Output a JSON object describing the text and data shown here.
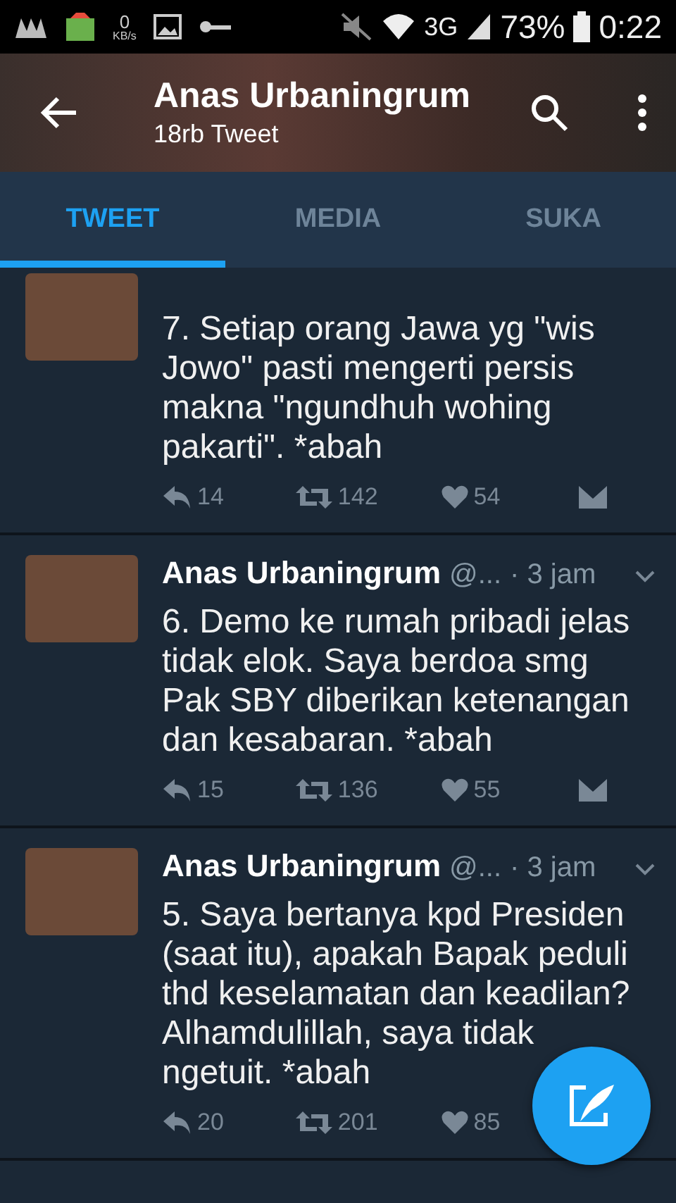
{
  "status_bar": {
    "speed_value": "0",
    "speed_unit": "KB/s",
    "network": "3G",
    "battery": "73%",
    "time": "0:22"
  },
  "header": {
    "title": "Anas Urbaningrum",
    "subtitle": "18rb Tweet"
  },
  "tabs": [
    {
      "label": "TWEET",
      "selected": true
    },
    {
      "label": "MEDIA",
      "selected": false
    },
    {
      "label": "SUKA",
      "selected": false
    }
  ],
  "tweets": [
    {
      "text": "7. Setiap orang Jawa yg \"wis Jowo\" pasti mengerti persis makna \"ngundhuh wohing pakarti\". *abah",
      "replies": "14",
      "retweets": "142",
      "likes": "54",
      "message_icon": true
    },
    {
      "name": "Anas Urbaningrum",
      "handle": "@...",
      "time": "· 3 jam",
      "text": "6. Demo ke rumah pribadi jelas tidak elok. Saya berdoa smg Pak SBY diberikan ketenangan dan kesabaran. *abah",
      "replies": "15",
      "retweets": "136",
      "likes": "55",
      "message_icon": true
    },
    {
      "name": "Anas Urbaningrum",
      "handle": "@...",
      "time": "· 3 jam",
      "text": "5. Saya bertanya kpd Presiden (saat itu), apakah Bapak peduli thd keselamatan dan keadilan? Alhamdulillah, saya tidak ngetuit. *abah",
      "replies": "20",
      "retweets": "201",
      "likes": "85"
    }
  ]
}
